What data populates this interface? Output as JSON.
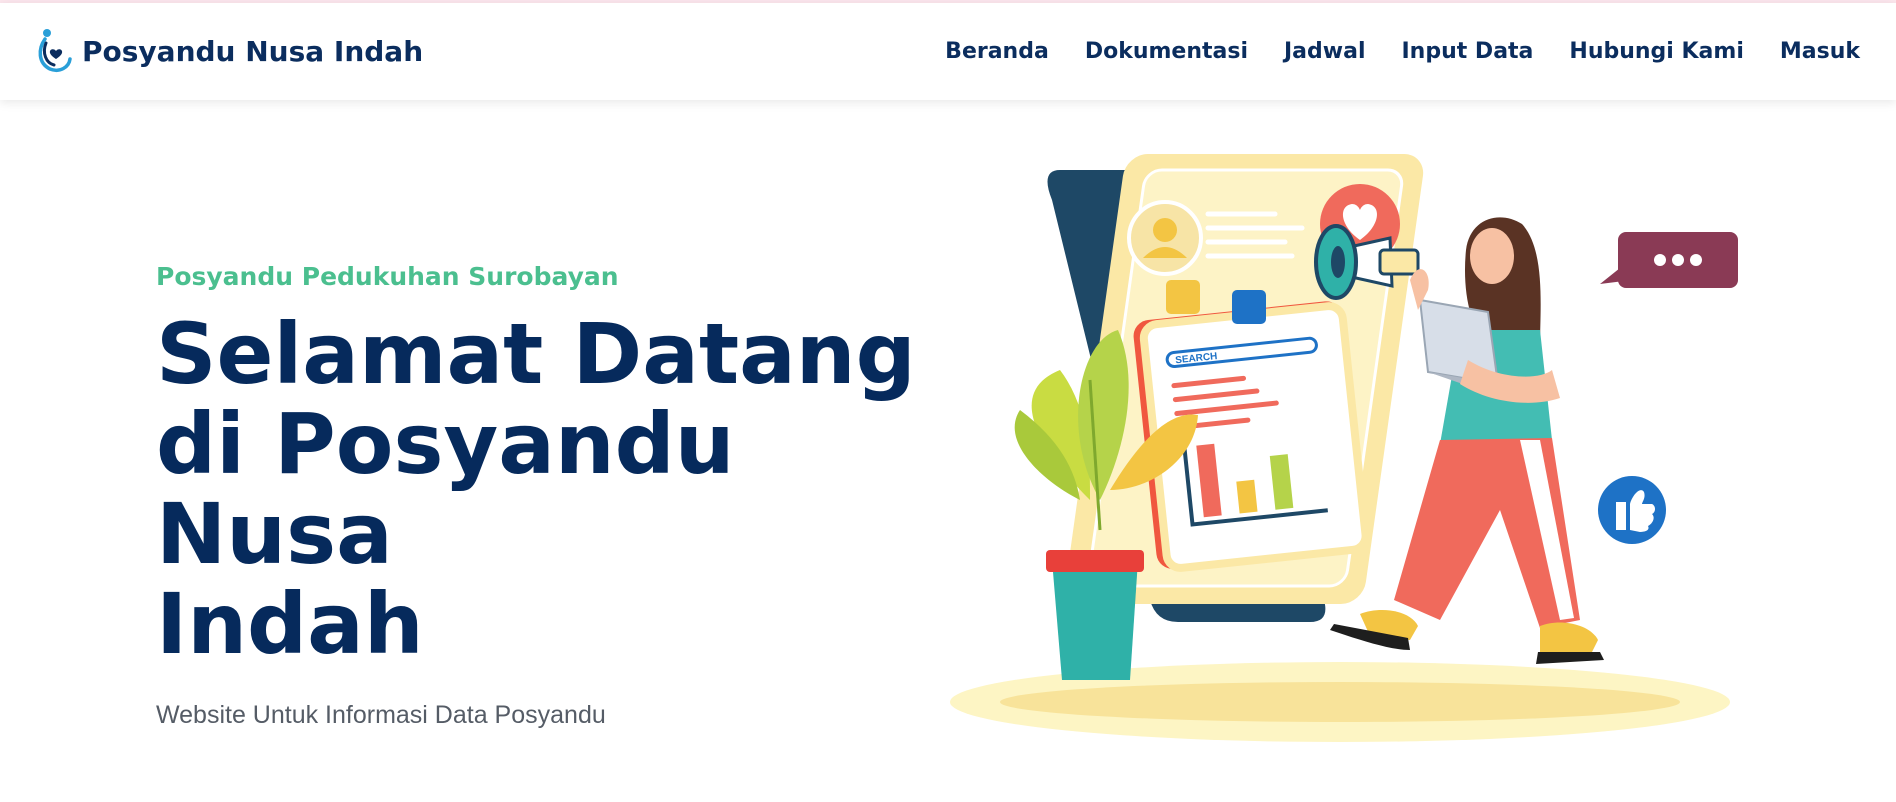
{
  "brand": {
    "name": "Posyandu Nusa Indah",
    "logo": "heart-hands-logo-icon"
  },
  "nav": {
    "items": [
      {
        "label": "Beranda"
      },
      {
        "label": "Dokumentasi"
      },
      {
        "label": "Jadwal"
      },
      {
        "label": "Input Data"
      },
      {
        "label": "Hubungi Kami"
      },
      {
        "label": "Masuk"
      }
    ]
  },
  "hero": {
    "subtitle": "Posyandu Pedukuhan Surobayan",
    "headline_line1": "Selamat Datang",
    "headline_line2": "di Posyandu Nusa",
    "headline_line3": "Indah",
    "tagline": "Website Untuk Informasi Data Posyandu"
  },
  "illustration": {
    "search_label": "SEARCH",
    "icons": [
      "megaphone-icon",
      "heart-icon",
      "chat-bubble-icon",
      "thumbs-up-icon",
      "laptop-icon",
      "plant-icon"
    ]
  },
  "colors": {
    "primary": "#0b2d5e",
    "accent_green": "#4bbf8f",
    "text_muted": "#555c66"
  }
}
